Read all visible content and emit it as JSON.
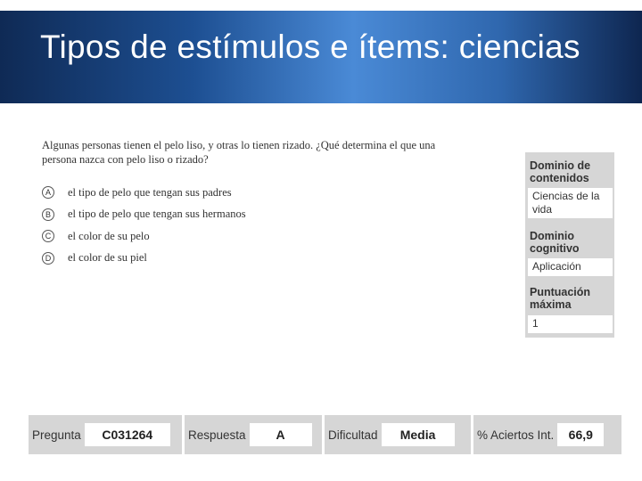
{
  "slide": {
    "title": "Tipos de estímulos e ítems: ciencias"
  },
  "item": {
    "question": "Algunas personas tienen el pelo liso, y otras lo tienen rizado. ¿Qué determina el que una persona nazca con pelo liso o rizado?",
    "options": [
      {
        "letter": "A",
        "text": "el tipo de pelo que tengan sus padres"
      },
      {
        "letter": "B",
        "text": "el tipo de pelo que tengan sus hermanos"
      },
      {
        "letter": "C",
        "text": "el color de su pelo"
      },
      {
        "letter": "D",
        "text": "el color de su piel"
      }
    ]
  },
  "side": {
    "content_label": "Dominio de contenidos",
    "content_value": "Ciencias de la vida",
    "cognitive_label": "Dominio cognitivo",
    "cognitive_value": "Aplicación",
    "score_label": "Puntuación máxima",
    "score_value": "1"
  },
  "footer": {
    "pregunta_label": "Pregunta",
    "pregunta_value": "C031264",
    "respuesta_label": "Respuesta",
    "respuesta_value": "A",
    "dificultad_label": "Dificultad",
    "dificultad_value": "Media",
    "aciertos_label": "% Aciertos Int.",
    "aciertos_value": "66,9"
  }
}
